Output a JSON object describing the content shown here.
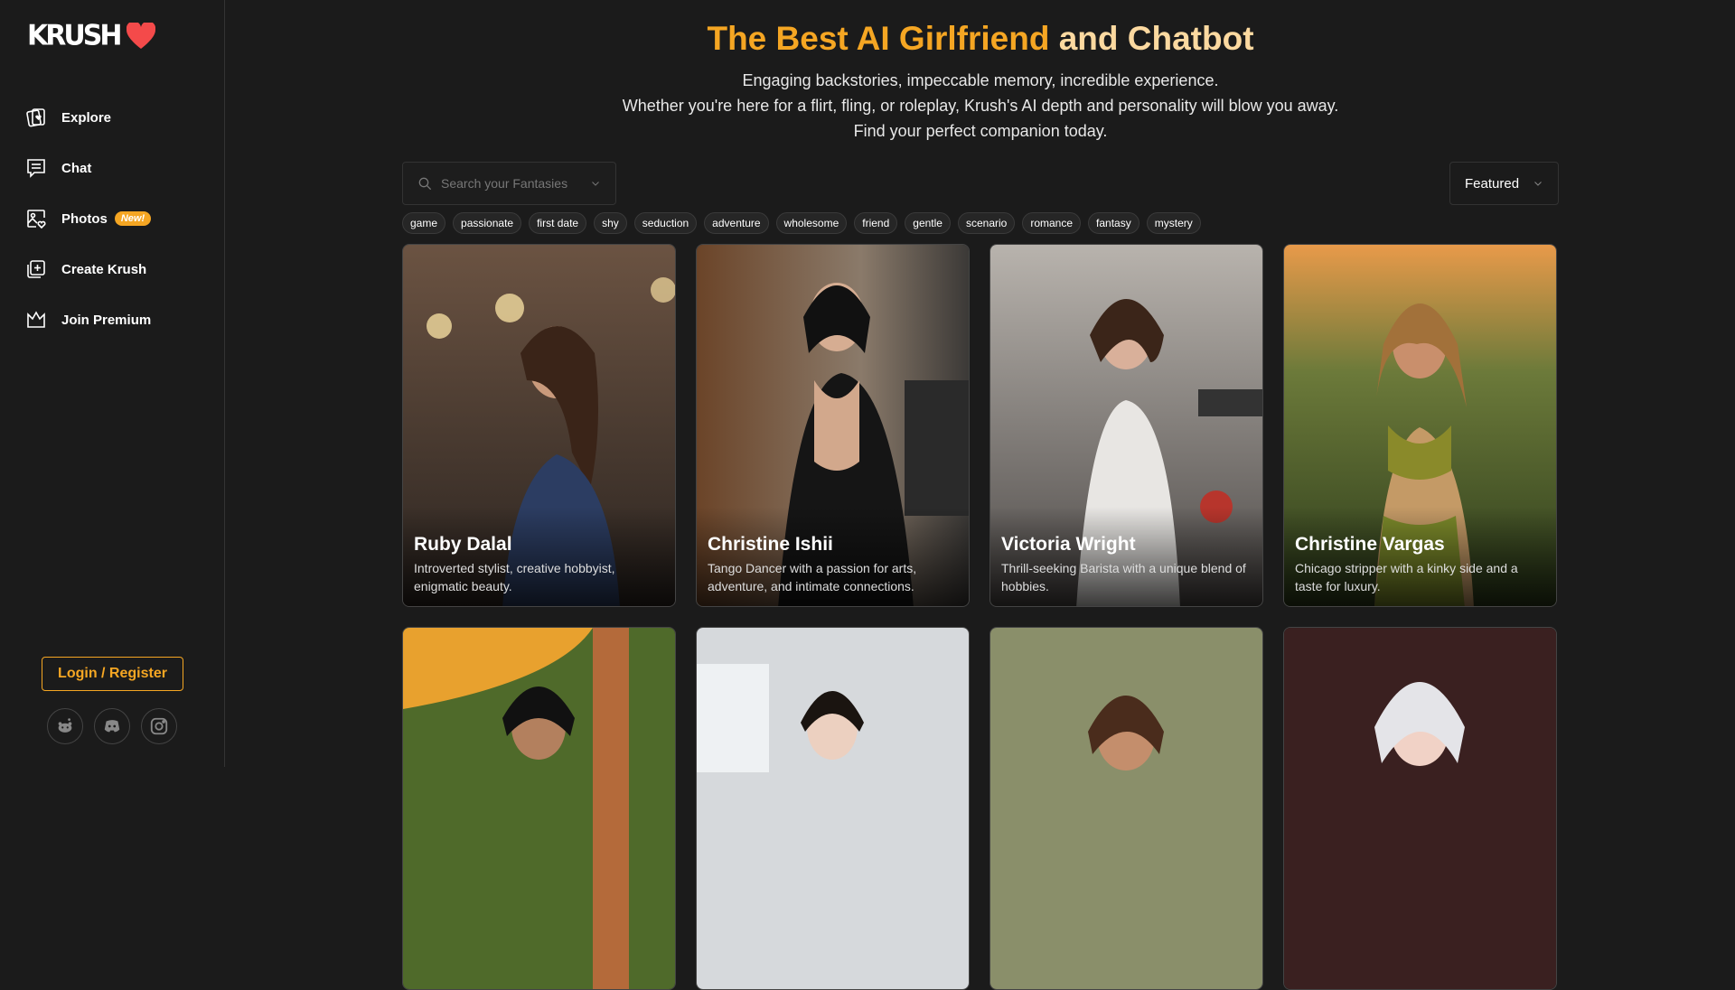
{
  "brand": {
    "name": "KRUSH",
    "heart_color": "#f44a4a",
    "accent": "#f5a623"
  },
  "sidebar": {
    "items": [
      {
        "label": "Explore",
        "icon": "cards-heart-icon"
      },
      {
        "label": "Chat",
        "icon": "chat-bubble-icon"
      },
      {
        "label": "Photos",
        "icon": "photo-heart-icon",
        "badge": "New!"
      },
      {
        "label": "Create Krush",
        "icon": "add-square-icon"
      },
      {
        "label": "Join Premium",
        "icon": "crown-icon"
      }
    ],
    "login_label": "Login / Register",
    "socials": [
      "reddit-icon",
      "discord-icon",
      "instagram-icon"
    ]
  },
  "header": {
    "title_part1": "The Best AI Girlfriend",
    "title_part2": " and Chatbot",
    "sub_lines": [
      "Engaging backstories, impeccable memory, incredible experience.",
      "Whether you're here for a flirt, fling, or roleplay, Krush's AI depth and personality will blow you away.",
      "Find your perfect companion today."
    ]
  },
  "search": {
    "placeholder": "Search your Fantasies"
  },
  "sort": {
    "selected": "Featured"
  },
  "tags": [
    "game",
    "passionate",
    "first date",
    "shy",
    "seduction",
    "adventure",
    "wholesome",
    "friend",
    "gentle",
    "scenario",
    "romance",
    "fantasy",
    "mystery"
  ],
  "cards": [
    {
      "name": "Ruby Dalal",
      "desc": "Introverted stylist, creative hobbyist, enigmatic beauty."
    },
    {
      "name": "Christine Ishii",
      "desc": "Tango Dancer with a passion for arts, adventure, and intimate connections."
    },
    {
      "name": "Victoria Wright",
      "desc": "Thrill-seeking Barista with a unique blend of hobbies."
    },
    {
      "name": "Christine Vargas",
      "desc": "Chicago stripper with a kinky side and a taste for luxury."
    },
    {
      "name": "",
      "desc": ""
    },
    {
      "name": "",
      "desc": ""
    },
    {
      "name": "",
      "desc": ""
    },
    {
      "name": "",
      "desc": ""
    }
  ]
}
